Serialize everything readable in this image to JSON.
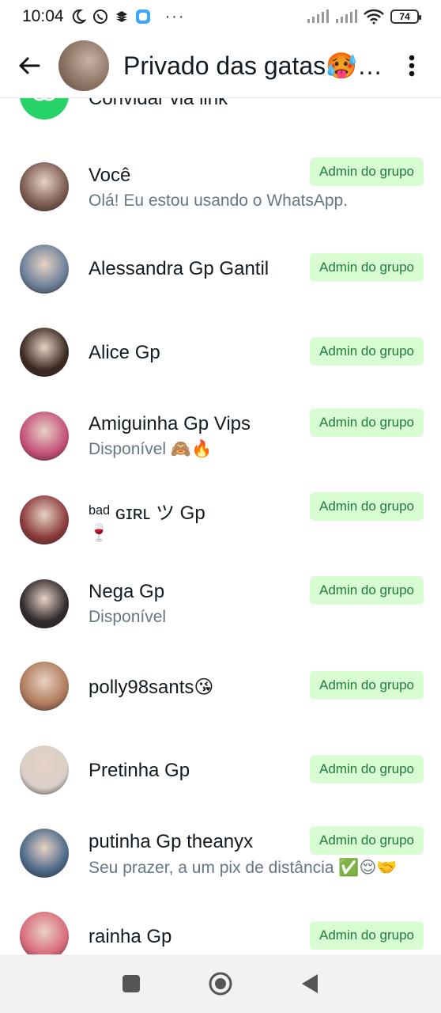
{
  "status_bar": {
    "time": "10:04",
    "more": "···",
    "battery": "74"
  },
  "header": {
    "title": "Privado das gatas🥵…"
  },
  "invite": {
    "label": "Convidar via link"
  },
  "members": [
    {
      "name": "Você",
      "status": "Olá! Eu estou usando o WhatsApp.",
      "badge": "Admin do grupo",
      "avatar_color": "#7a5a4e"
    },
    {
      "name": "Alessandra Gp Gantil",
      "status": "",
      "badge": "Admin do grupo",
      "avatar_color": "#6a7f99"
    },
    {
      "name": "Alice Gp",
      "status": "",
      "badge": "Admin do grupo",
      "avatar_color": "#3b2a22"
    },
    {
      "name": "Amiguinha Gp Vips",
      "status": "Disponível 🙈🔥",
      "badge": "Admin do grupo",
      "avatar_color": "#c4507a"
    },
    {
      "name": "ᵇᵃᵈ ɢɪʀʟ   ツ Gp",
      "status": "🍷",
      "badge": "Admin do grupo",
      "avatar_color": "#8a3b3b"
    },
    {
      "name": "Nega Gp",
      "status": "Disponível",
      "badge": "Admin do grupo",
      "avatar_color": "#2f2a2c"
    },
    {
      "name": "polly98sants😘",
      "status": "",
      "badge": "Admin do grupo",
      "avatar_color": "#b07a5c"
    },
    {
      "name": "Pretinha Gp",
      "status": "",
      "badge": "Admin do grupo",
      "avatar_color": "#d8cfc8"
    },
    {
      "name": "putinha Gp theanyx",
      "status": "Seu prazer, a um pix de distância ✅😌🤝",
      "badge": "Admin do grupo",
      "avatar_color": "#4c6a8a"
    },
    {
      "name": "rainha Gp",
      "status": "",
      "badge": "Admin do grupo",
      "avatar_color": "#d86a7a"
    }
  ],
  "colors": {
    "accent": "#25d366",
    "badge_bg": "#d9fdd3",
    "badge_text": "#1f7a3d",
    "secondary_text": "#667781"
  }
}
